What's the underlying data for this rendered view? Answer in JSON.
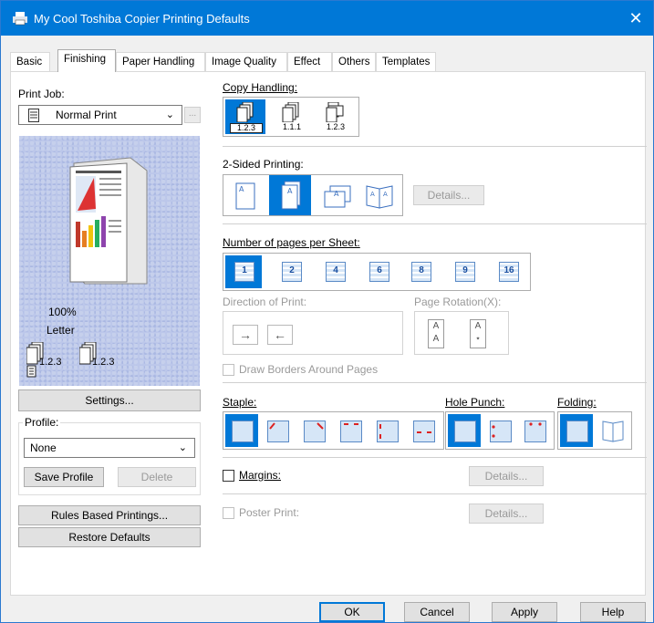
{
  "window": {
    "title": "My Cool Toshiba Copier Printing Defaults",
    "close_glyph": "✕"
  },
  "tabs": [
    {
      "label": "Basic"
    },
    {
      "label": "Finishing"
    },
    {
      "label": "Paper Handling"
    },
    {
      "label": "Image Quality"
    },
    {
      "label": "Effect"
    },
    {
      "label": "Others"
    },
    {
      "label": "Templates"
    }
  ],
  "left": {
    "print_job_label": "Print Job:",
    "print_job_value": "Normal Print",
    "print_job_more": "...",
    "preview": {
      "zoom": "100%",
      "paper": "Letter",
      "copy1": "1.2.3",
      "copy2": "1.2.3"
    },
    "settings_button": "Settings...",
    "profile_label": "Profile:",
    "profile_value": "None",
    "save_profile_button": "Save Profile",
    "delete_button": "Delete",
    "rules_button": "Rules Based Printings...",
    "restore_button": "Restore Defaults"
  },
  "copy_handling": {
    "label": "Copy Handling:",
    "options": [
      {
        "caption": "1.2.3",
        "selected": true
      },
      {
        "caption": "1.1.1",
        "selected": false
      },
      {
        "caption": "1.2.3",
        "selected": false
      }
    ]
  },
  "two_sided": {
    "label": "2-Sided Printing:",
    "details_button": "Details...",
    "selected_index": 1
  },
  "pages_per_sheet": {
    "label": "Number of pages per Sheet:",
    "options": [
      "1",
      "2",
      "4",
      "6",
      "8",
      "9",
      "16"
    ],
    "selected_index": 0,
    "direction_label": "Direction of Print:",
    "rotation_label": "Page Rotation(X):",
    "draw_borders_label": "Draw Borders Around Pages"
  },
  "staple": {
    "label": "Staple:",
    "selected_index": 0
  },
  "hole_punch": {
    "label": "Hole Punch:",
    "selected_index": 0
  },
  "folding": {
    "label": "Folding:",
    "selected_index": 0
  },
  "margins": {
    "label": "Margins:",
    "details_button": "Details..."
  },
  "poster": {
    "label": "Poster Print:",
    "details_button": "Details..."
  },
  "footer": {
    "ok": "OK",
    "cancel": "Cancel",
    "apply": "Apply",
    "help": "Help"
  },
  "colors": {
    "accent": "#0078d7",
    "page_blue": "#d6e6f7",
    "preview_bg": "#bcc7ea"
  }
}
